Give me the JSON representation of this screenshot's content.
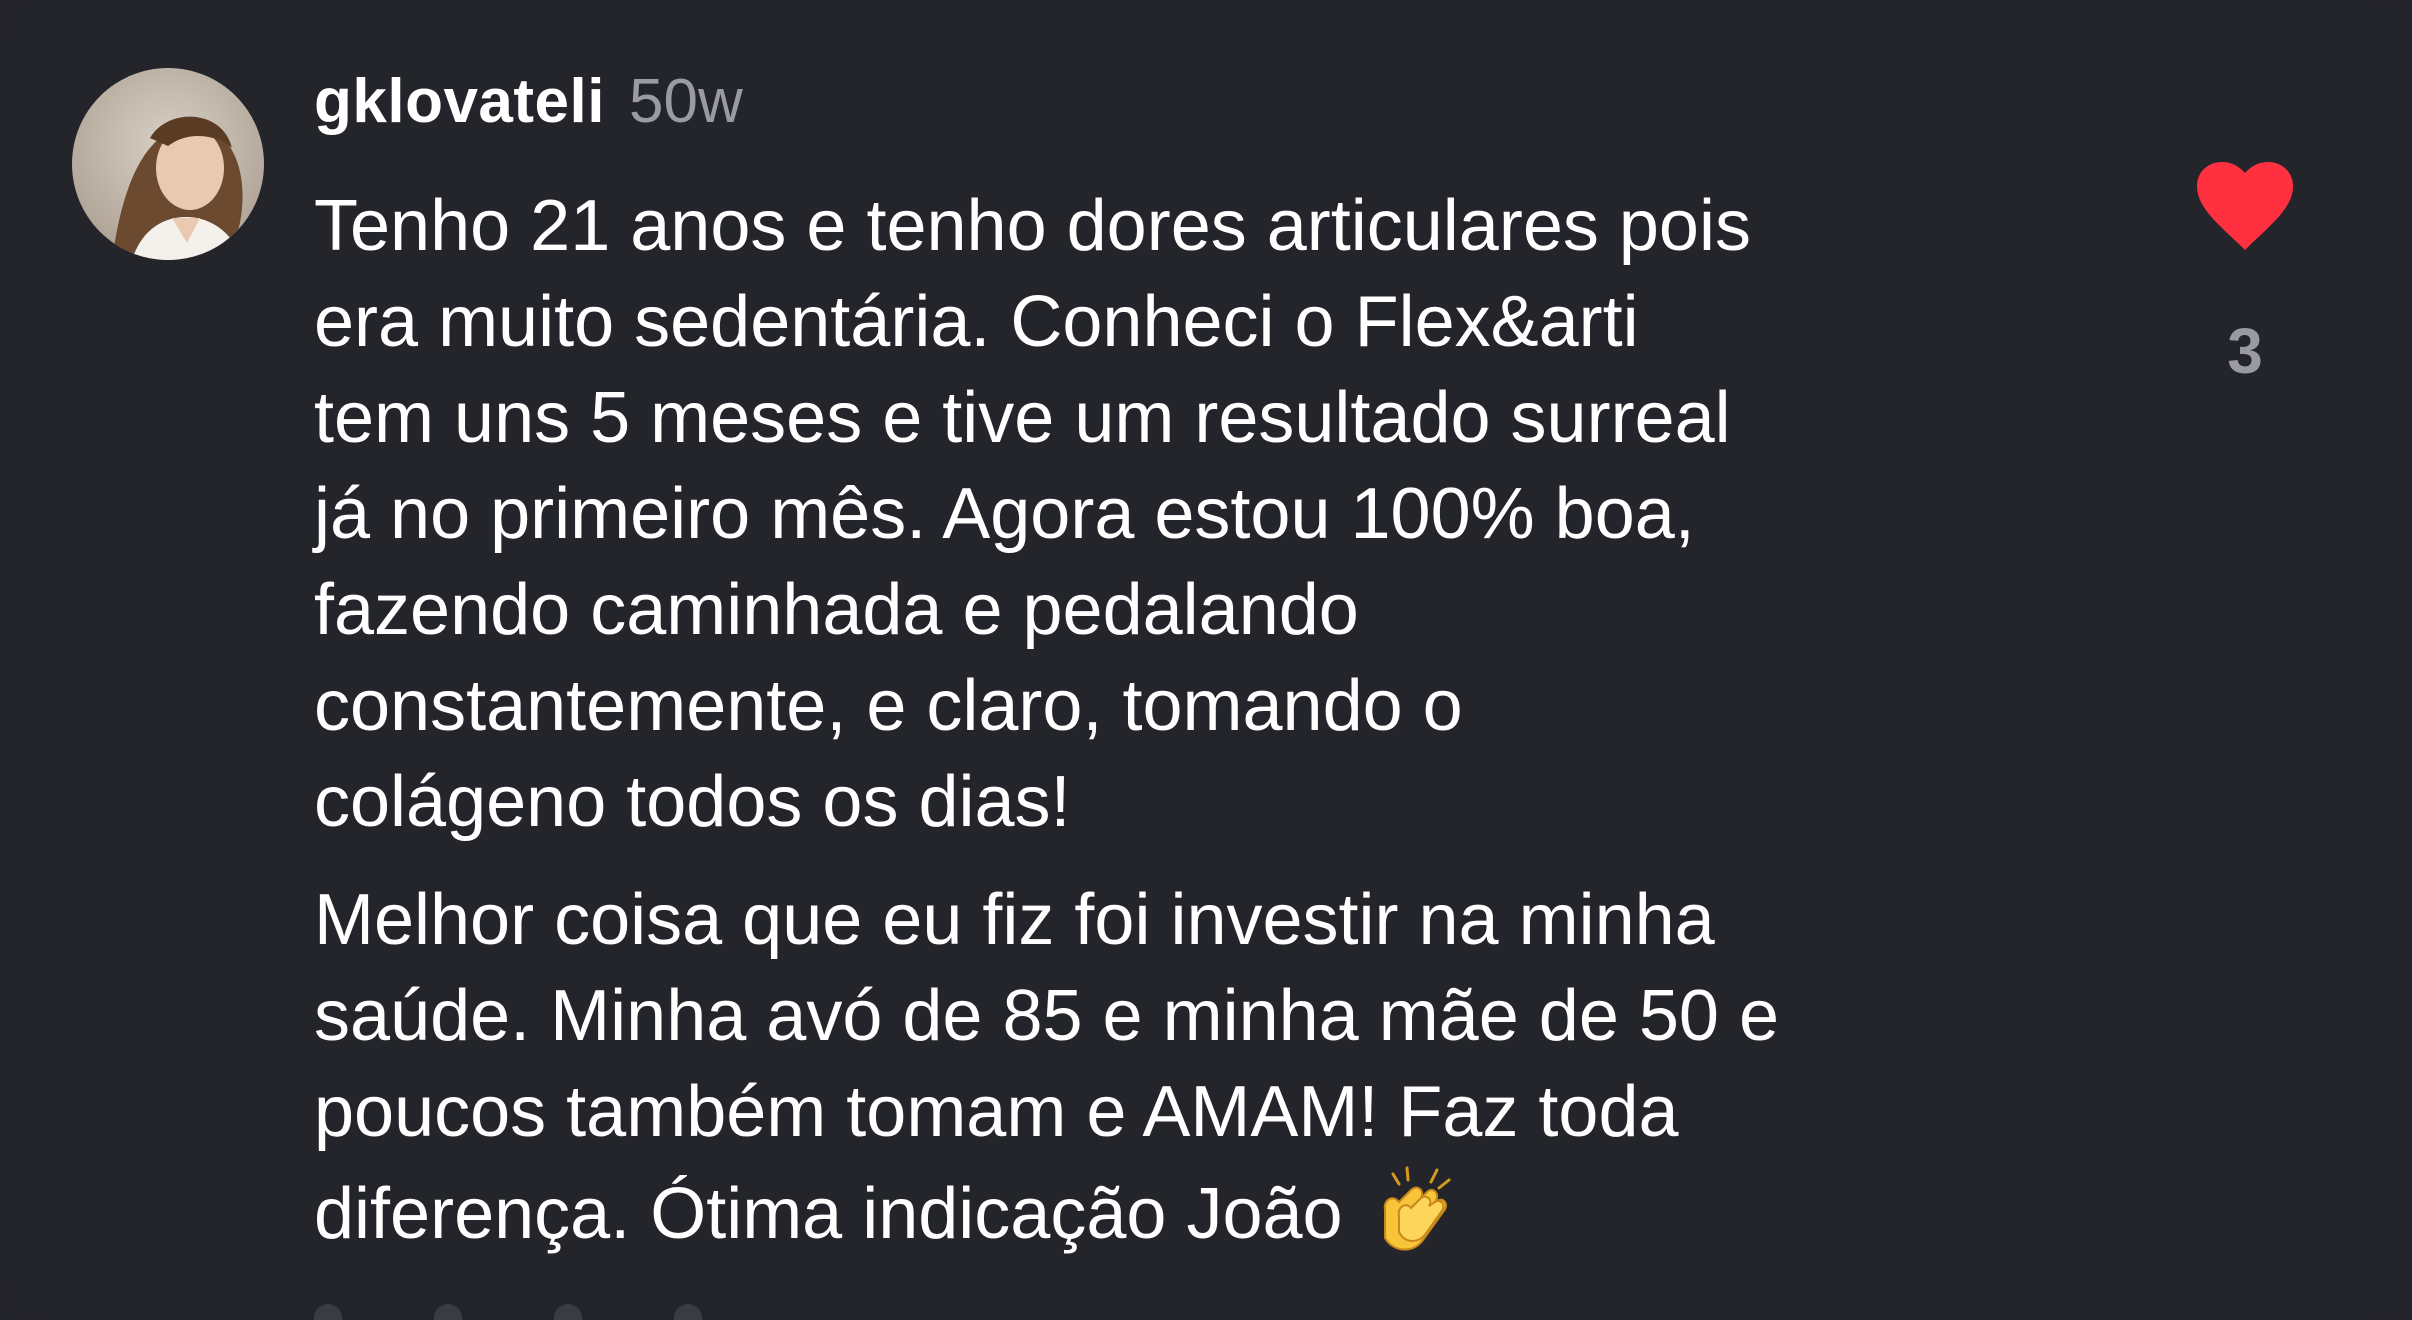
{
  "comment": {
    "username": "gklovateli",
    "time_ago": "50w",
    "paragraphs": [
      "Tenho 21 anos e tenho dores articulares pois\nera muito sedentária. Conheci o Flex&arti\ntem uns 5 meses e tive um resultado surreal\njá no primeiro mês. Agora estou 100% boa,\nfazendo caminhada e pedalando\nconstantemente, e claro, tomando o\ncolágeno todos os dias!",
      "Melhor coisa que eu fiz foi investir na minha\nsaúde. Minha avó de 85 e minha mãe de 50 e\npoucos também tomam e AMAM! Faz toda\ndiferença. Ótima indicação João"
    ],
    "trailing_emoji": "clapping-hands-emoji",
    "like_count": "3",
    "liked": true
  },
  "colors": {
    "background": "#24252b",
    "text": "#ffffff",
    "muted": "#9a9ba2",
    "heart": "#ff3040"
  },
  "icons": {
    "like": "heart-icon",
    "avatar": "profile-photo"
  }
}
